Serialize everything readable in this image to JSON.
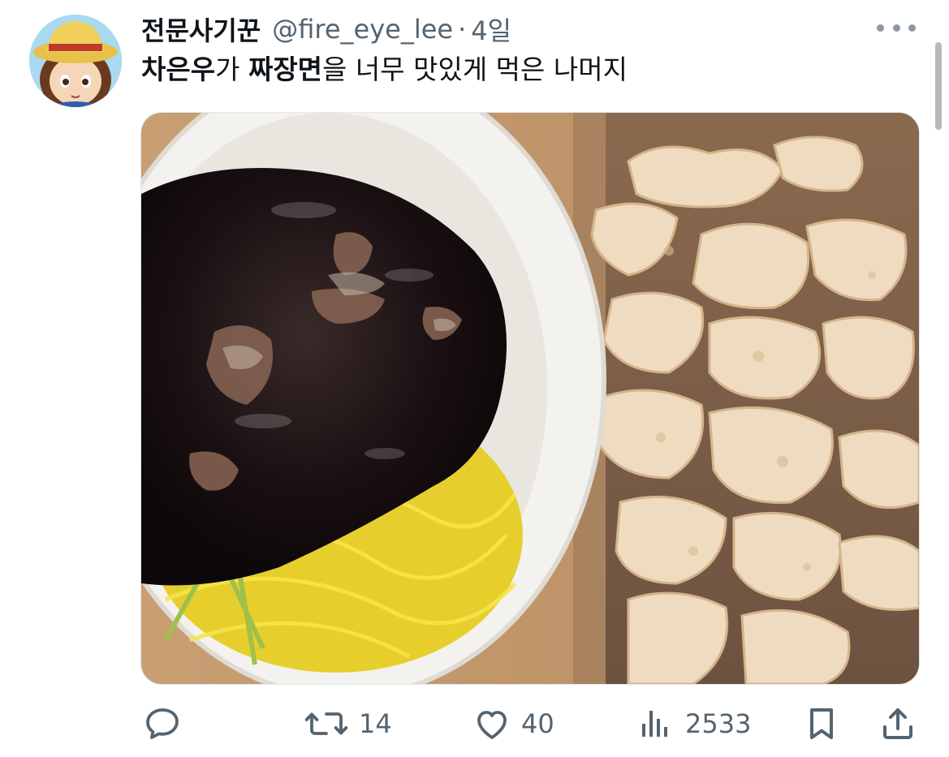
{
  "tweet": {
    "author": {
      "display_name": "전문사기꾼",
      "handle": "@fire_eye_lee",
      "separator": "·",
      "time": "4일"
    },
    "text": {
      "part1": "차은우",
      "part2": "가 ",
      "part3": "짜장면",
      "part4": "을 너무 맛있게 먹은 나머지"
    },
    "actions": {
      "reply_count": "",
      "retweet_count": "14",
      "like_count": "40",
      "view_count": "2533"
    }
  },
  "icons": {
    "more": "more-horizontal-icon",
    "reply": "reply-icon",
    "retweet": "retweet-icon",
    "like": "heart-icon",
    "views": "views-icon",
    "bookmark": "bookmark-icon",
    "share": "share-icon"
  },
  "colors": {
    "text_primary": "#0f1419",
    "text_secondary": "#536471"
  }
}
